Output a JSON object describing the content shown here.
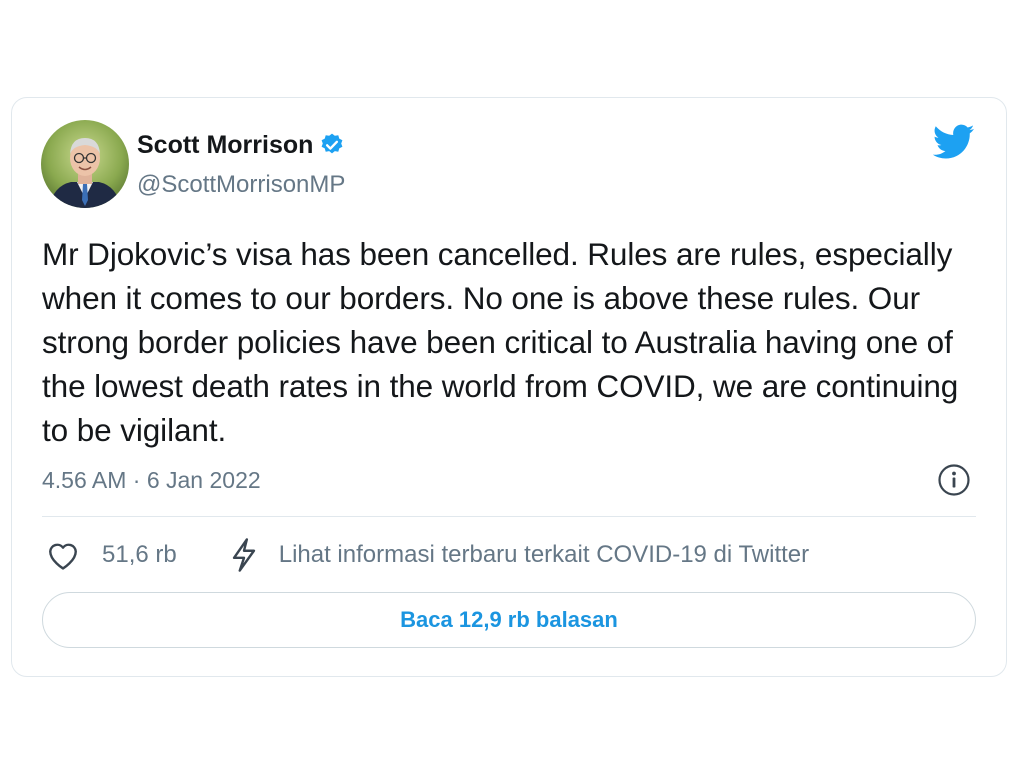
{
  "author": {
    "name": "Scott Morrison",
    "handle": "@ScottMorrisonMP",
    "verified": true
  },
  "tweet": {
    "text": "Mr Djokovic’s visa has been cancelled. Rules are rules, especially when it comes to our borders. No one is above these rules. Our strong border policies have been critical to Australia having one of the lowest death rates in the world from COVID, we are continuing to be vigilant.",
    "timestamp": "4.56 AM · 6 Jan 2022"
  },
  "actions": {
    "like_count": "51,6 rb",
    "covid_info_label": "Lihat informasi terbaru terkait COVID-19 di Twitter",
    "read_replies_label": "Baca 12,9 rb balasan"
  },
  "icons": {
    "brand": "twitter-bird-icon",
    "verified": "verified-badge-icon",
    "info": "info-icon",
    "like": "heart-icon",
    "covid": "lightning-icon"
  },
  "colors": {
    "twitter_blue": "#1da1f2",
    "link_blue": "#1b95e0",
    "text_primary": "#14171a",
    "text_secondary": "#657786",
    "border": "#e1e8ed"
  }
}
